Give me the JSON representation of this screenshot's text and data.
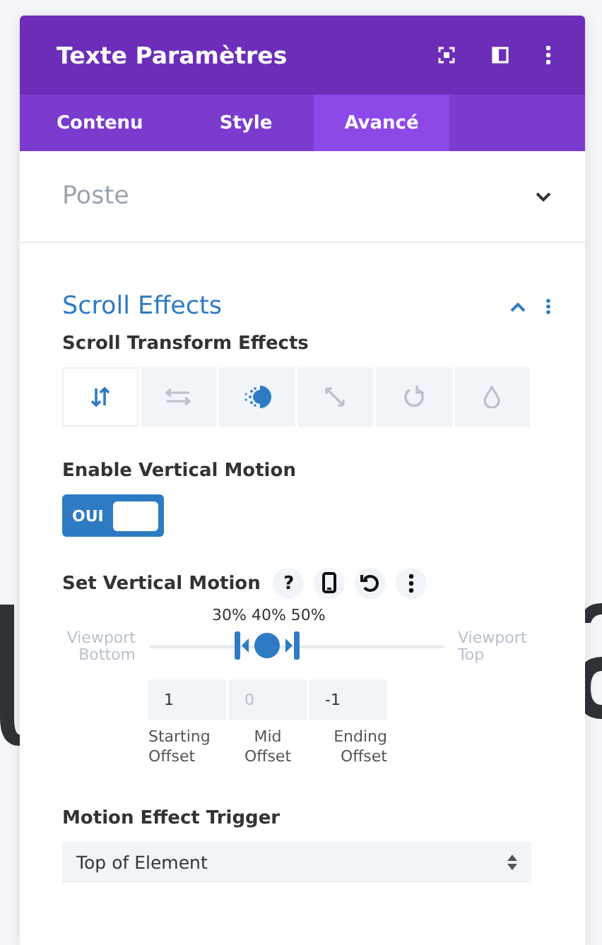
{
  "window": {
    "title": "Texte Paramètres"
  },
  "tabs": [
    {
      "label": "Contenu",
      "selected": false
    },
    {
      "label": "Style",
      "selected": false
    },
    {
      "label": "Avancé",
      "selected": true
    }
  ],
  "sections": [
    {
      "title": "Poste",
      "expanded": false
    },
    {
      "title": "Scroll Effects",
      "expanded": true
    }
  ],
  "transform_effects": {
    "label": "Scroll Transform Effects",
    "options": [
      {
        "kind": "vertical",
        "selected": true,
        "enabled": false
      },
      {
        "kind": "horizontal",
        "selected": false,
        "enabled": false
      },
      {
        "kind": "fade",
        "selected": false,
        "enabled": true
      },
      {
        "kind": "scale",
        "selected": false,
        "enabled": false
      },
      {
        "kind": "rotate",
        "selected": false,
        "enabled": false
      },
      {
        "kind": "blur",
        "selected": false,
        "enabled": false
      }
    ]
  },
  "vertical_motion": {
    "label": "Enable Vertical Motion",
    "on": true,
    "on_label": "OUI"
  },
  "set_motion": {
    "label": "Set Vertical Motion",
    "help": "?",
    "percentages": "30% 40% 50%",
    "left_label": "Viewport Bottom",
    "right_label": "Viewport Top",
    "level": 0.4,
    "offsets": [
      {
        "value": "1",
        "label": "Starting Offset"
      },
      {
        "placeholder": "0",
        "label": "Mid Offset"
      },
      {
        "value": "-1",
        "label": "Ending Offset"
      }
    ]
  },
  "trigger": {
    "label": "Motion Effect Trigger",
    "value": "Top of Element"
  }
}
